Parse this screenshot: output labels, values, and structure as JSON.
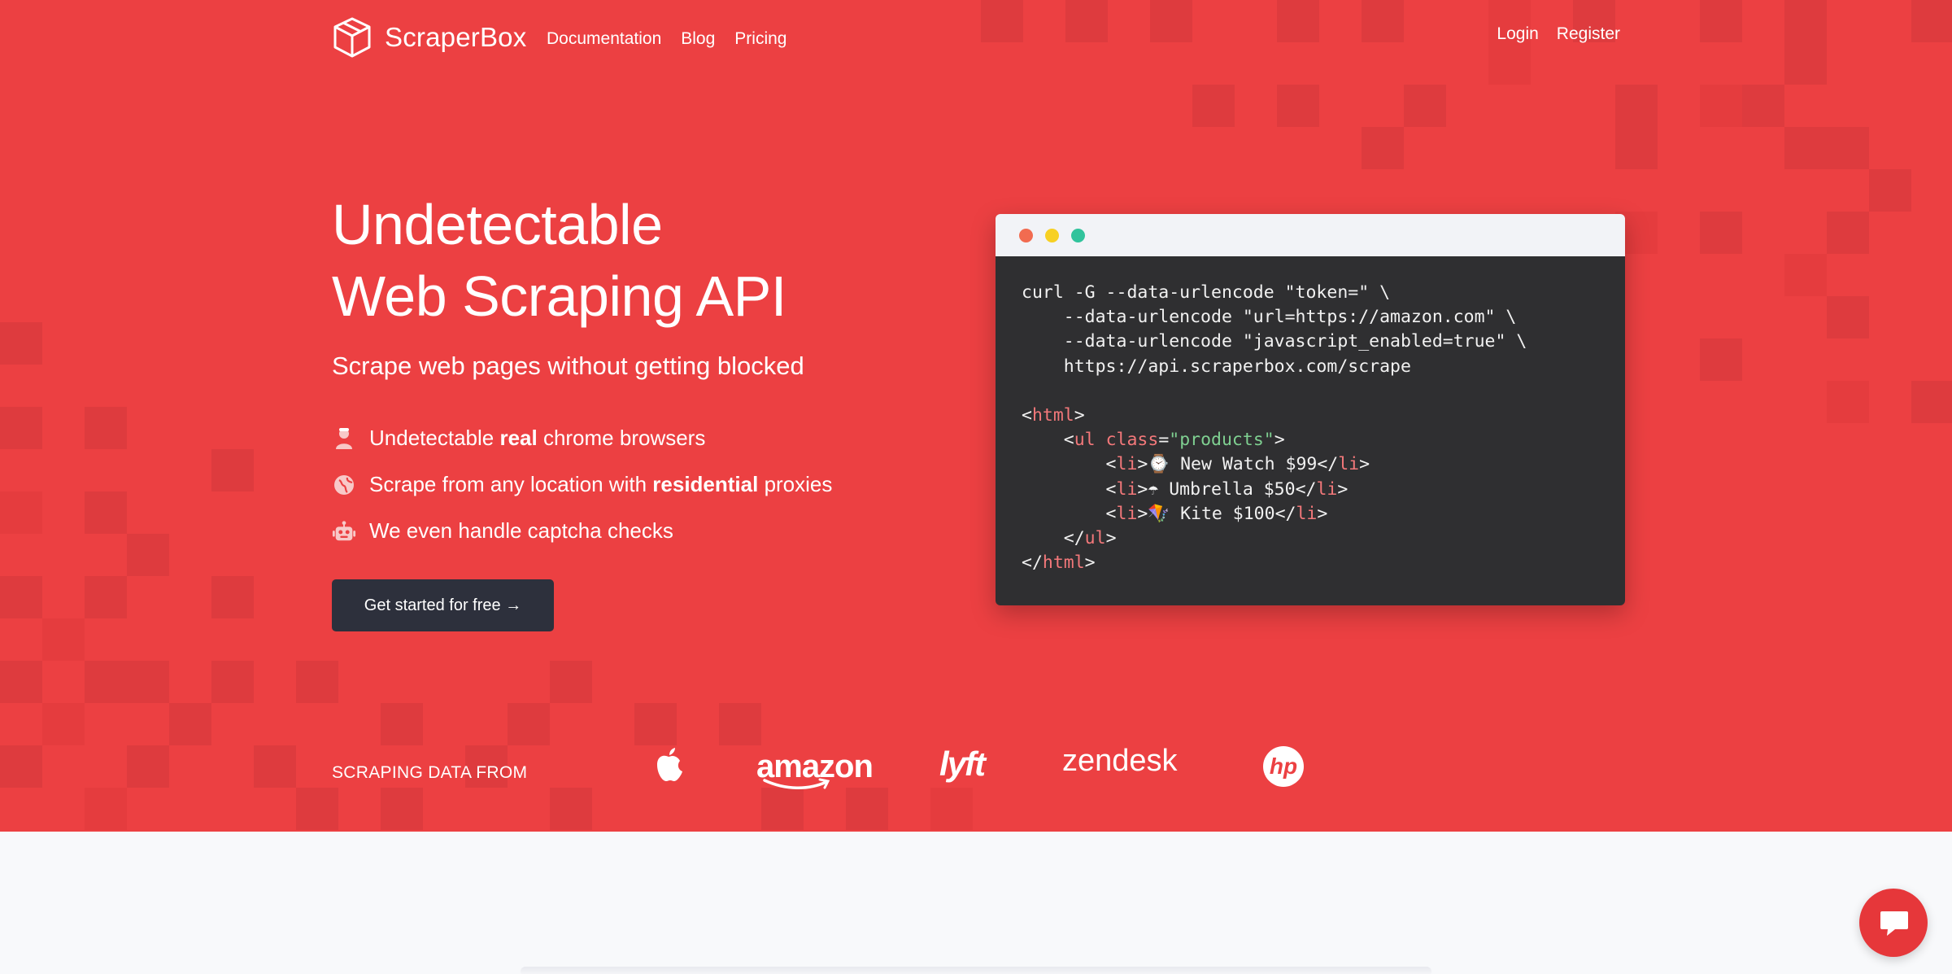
{
  "nav": {
    "brand": "ScraperBox",
    "links": [
      "Documentation",
      "Blog",
      "Pricing"
    ],
    "login": "Login",
    "register": "Register"
  },
  "hero": {
    "headline_line1": "Undetectable",
    "headline_line2": "Web Scraping API",
    "subheadline": "Scrape web pages without getting blocked",
    "features": [
      {
        "icon": "user-icon",
        "pre": "Undetectable ",
        "bold": "real",
        "post": " chrome browsers"
      },
      {
        "icon": "globe-icon",
        "pre": "Scrape from any location with ",
        "bold": "residential",
        "post": " proxies"
      },
      {
        "icon": "robot-icon",
        "pre": "We even handle captcha checks",
        "bold": "",
        "post": ""
      }
    ],
    "cta": "Get started for free →"
  },
  "code": {
    "line1": "curl -G --data-urlencode \"token=\" \\",
    "line2": "    --data-urlencode \"url=https://amazon.com\" \\",
    "line3": "    --data-urlencode \"javascript_enabled=true\" \\",
    "line4": "    https://api.scraperbox.com/scrape",
    "html_open": "html",
    "ul": "ul",
    "ul_attr": "class",
    "ul_value": "\"products\"",
    "li": "li",
    "items": [
      {
        "emoji": "⌚",
        "text": " New Watch $99"
      },
      {
        "emoji": "☂",
        "text": " Umbrella $50"
      },
      {
        "emoji": "🪁",
        "text": " Kite $100"
      }
    ]
  },
  "logos": {
    "label": "SCRAPING DATA FROM",
    "brands": [
      "amazon",
      "lyft",
      "zendesk",
      "hp"
    ]
  },
  "colors": {
    "hero_bg": "#ec4042",
    "cta_bg": "#2d303c",
    "code_bg": "#2f2f31"
  }
}
